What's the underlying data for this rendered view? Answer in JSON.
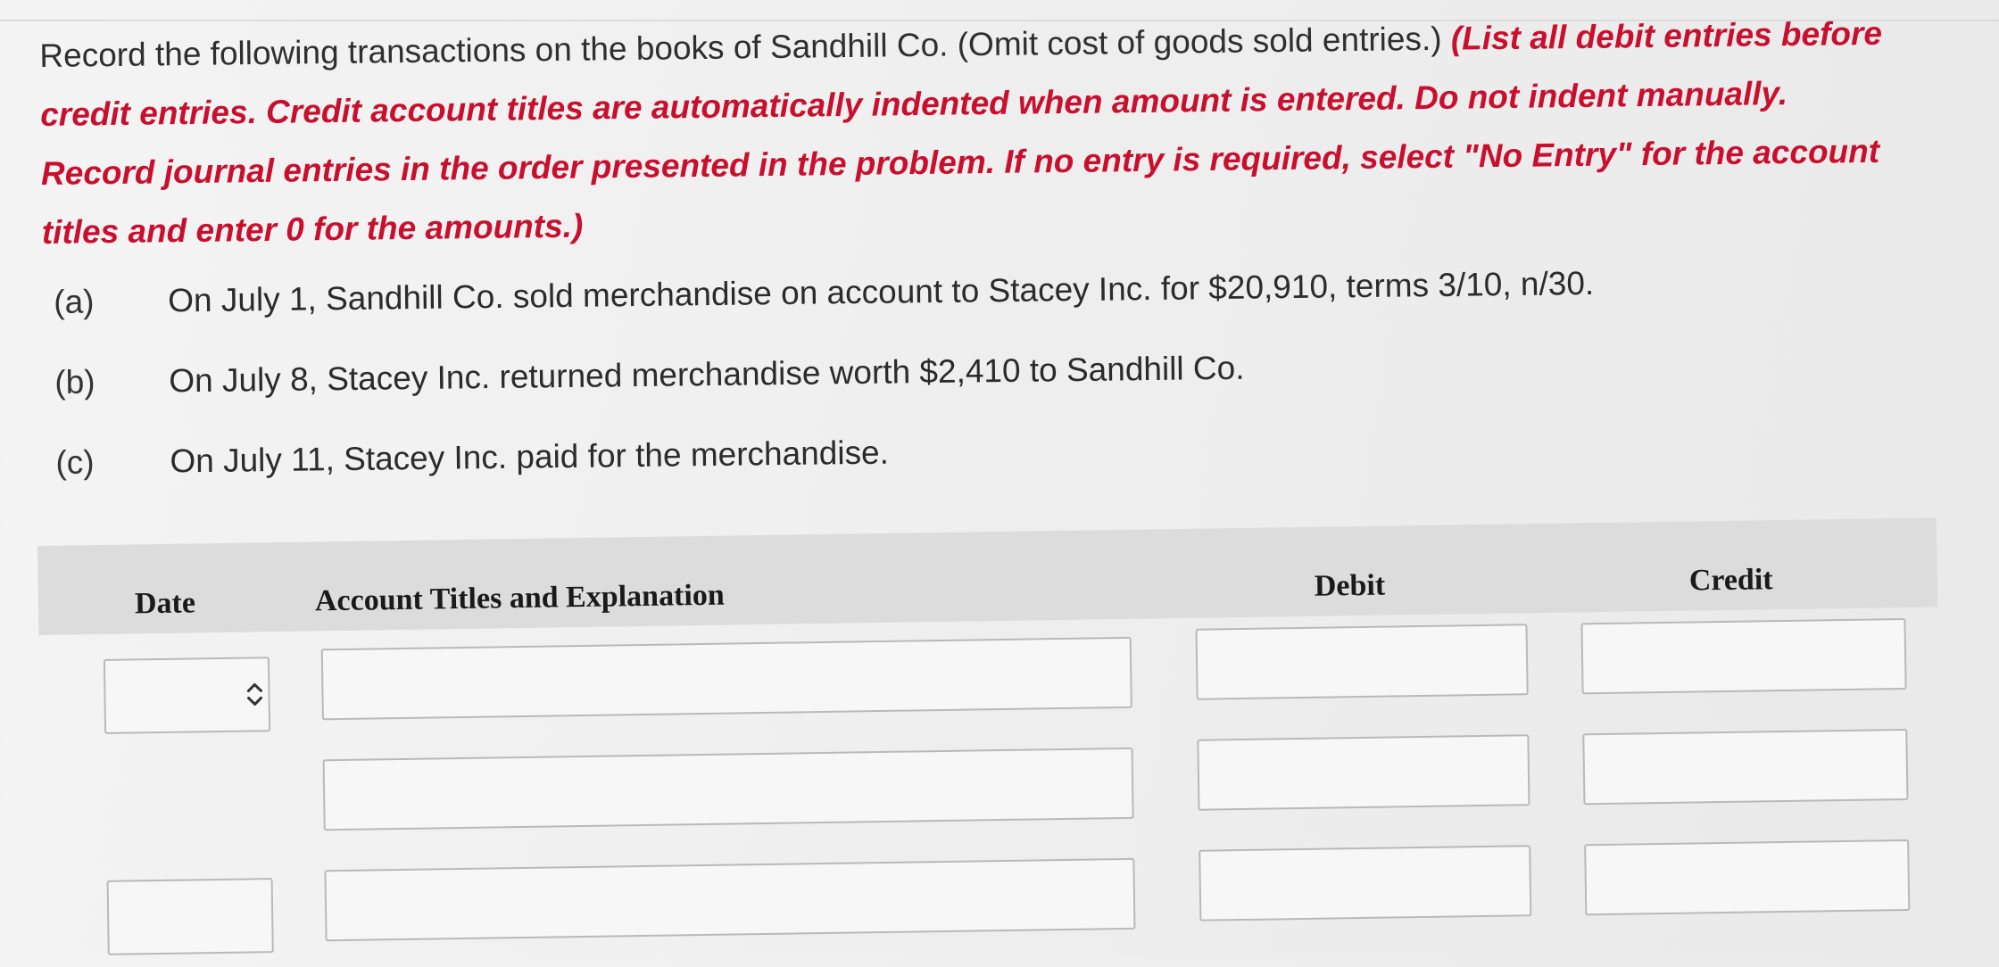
{
  "instructions": {
    "plain": "Record the following transactions on the books of Sandhill Co. (Omit cost of goods sold entries.) ",
    "emphasis": "(List all debit entries before credit entries. Credit account titles are automatically indented when amount is entered. Do not indent manually. Record journal entries in the order presented in the problem. If no entry is required, select \"No Entry\" for the account titles and enter 0 for the amounts.)"
  },
  "transactions": [
    {
      "letter": "(a)",
      "text": "On July 1, Sandhill Co. sold merchandise on account to Stacey Inc. for $20,910, terms 3/10, n/30."
    },
    {
      "letter": "(b)",
      "text": "On July 8, Stacey Inc. returned merchandise worth $2,410 to Sandhill Co."
    },
    {
      "letter": "(c)",
      "text": "On July 11, Stacey Inc. paid for the merchandise."
    }
  ],
  "journal": {
    "headers": {
      "date": "Date",
      "account": "Account Titles and Explanation",
      "debit": "Debit",
      "credit": "Credit"
    },
    "rows": [
      {
        "date": "",
        "account": "",
        "debit": "",
        "credit": ""
      },
      {
        "account": "",
        "debit": "",
        "credit": ""
      },
      {
        "date": "",
        "account": "",
        "debit": "",
        "credit": ""
      }
    ]
  },
  "icons": {
    "date_stepper": "up-down-chevron-icon"
  },
  "colors": {
    "emphasis_red": "#c8102e",
    "header_band": "#dcdcdc",
    "input_border": "#b9b9b9"
  }
}
